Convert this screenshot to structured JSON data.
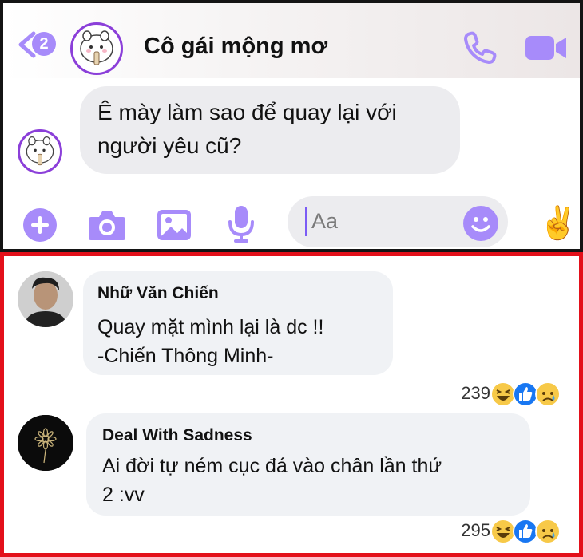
{
  "conversation": {
    "back_badge": "2",
    "contact_name": "Cô gái mộng mơ",
    "incoming_message": "Ê mày làm sao để quay lại với người yêu cũ?",
    "composer_placeholder": "Aa",
    "quick_reaction": "✌️"
  },
  "comments": [
    {
      "author": "Nhữ Văn Chiến",
      "lines": [
        "Quay mặt mình lại là dc !!",
        "-Chiến Thông Minh-"
      ],
      "reaction_count": "239",
      "reactions": [
        "haha-icon",
        "like-icon",
        "sad-icon"
      ]
    },
    {
      "author": "Deal With Sadness",
      "lines": [
        "Ai đời tự ném cục đá vào chân lần thứ",
        "2 :vv"
      ],
      "reaction_count": "295",
      "reactions": [
        "haha-icon",
        "like-icon",
        "sad-icon"
      ]
    }
  ],
  "colors": {
    "messenger_accent": "#a78bfa",
    "frame_top": "#141414",
    "frame_bottom": "#e3101a",
    "bubble_gray": "#ececef"
  }
}
